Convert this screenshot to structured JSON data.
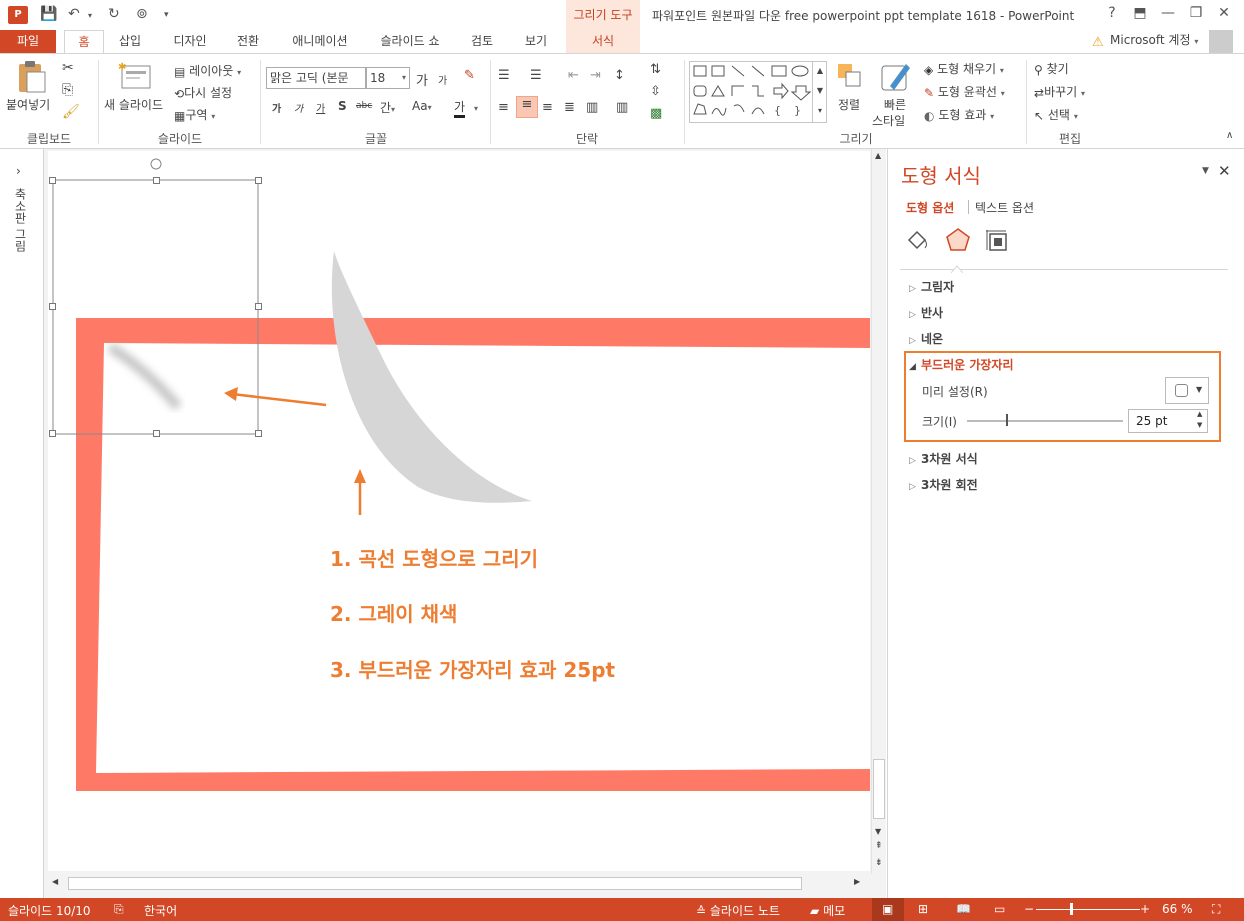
{
  "window": {
    "app_icon": "P",
    "title": "파워포인트 원본파일 다운 free powerpoint ppt template 1618 - PowerPoint",
    "context_group": "그리기 도구",
    "help": "?",
    "account": "Microsoft 계정"
  },
  "tabs": [
    "파일",
    "홈",
    "삽입",
    "디자인",
    "전환",
    "애니메이션",
    "슬라이드 쇼",
    "검토",
    "보기",
    "서식"
  ],
  "ribbon": {
    "clipboard": {
      "paste": "붙여넣기",
      "group": "클립보드"
    },
    "slides": {
      "new_slide": "새 슬라이드",
      "layout": "레이아웃",
      "reset": "다시 설정",
      "section": "구역",
      "group": "슬라이드"
    },
    "font": {
      "font_name": "맑은 고딕 (본문",
      "font_size": "18",
      "grow": "가",
      "shrink": "가",
      "bold": "가",
      "italic": "가",
      "underline": "가",
      "shadow": "S",
      "strike": "abc",
      "spacing": "간",
      "case": "Aa",
      "color": "가",
      "group": "글꼴"
    },
    "paragraph": {
      "group": "단락"
    },
    "drawing": {
      "arrange": "정렬",
      "quick_styles_1": "빠른",
      "quick_styles_2": "스타일",
      "shape_fill": "도형 채우기",
      "shape_outline": "도형 윤곽선",
      "shape_effects": "도형 효과",
      "group": "그리기"
    },
    "editing": {
      "find": "찾기",
      "replace": "바꾸기",
      "select": "선택",
      "group": "편집"
    }
  },
  "thumbnail_pane": {
    "label": "축소판 그림"
  },
  "slide": {
    "steps": [
      "1. 곡선 도형으로 그리기",
      "2. 그레이 채색",
      "3. 부드러운 가장자리 효과 25pt"
    ]
  },
  "format_pane": {
    "title": "도형 서식",
    "tab_shape": "도형 옵션",
    "tab_text": "텍스트 옵션",
    "sections": [
      "그림자",
      "반사",
      "네온"
    ],
    "soft_edges": {
      "title": "부드러운 가장자리",
      "preset_label": "미리 설정(R)",
      "size_label": "크기(I)",
      "size_value": "25 pt",
      "size_fraction": 0.25
    },
    "sections_after": [
      "3차원 서식",
      "3차원 회전"
    ]
  },
  "status": {
    "slide_index": "슬라이드 10/10",
    "language": "한국어",
    "notes": "슬라이드 노트",
    "comments": "메모",
    "zoom": "66 %"
  },
  "colors": {
    "accent": "#d24726",
    "frame": "#ff7a66",
    "step_text": "#ed7d31"
  }
}
